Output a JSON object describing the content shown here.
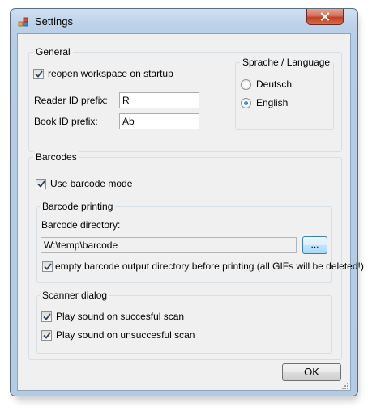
{
  "window": {
    "title": "Settings",
    "close_glyph": "✕",
    "app_icon": "settings-app-icon"
  },
  "general": {
    "label": "General",
    "reopen_workspace": {
      "label": "reopen workspace on startup",
      "checked": true
    },
    "reader_id": {
      "label": "Reader ID prefix:",
      "value": "R"
    },
    "book_id": {
      "label": "Book ID prefix:",
      "value": "Ab"
    },
    "language": {
      "label": "Sprache / Language",
      "options": [
        {
          "label": "Deutsch",
          "selected": false
        },
        {
          "label": "English",
          "selected": true
        }
      ]
    }
  },
  "barcodes": {
    "label": "Barcodes",
    "use_barcode_mode": {
      "label": "Use barcode mode",
      "checked": true
    },
    "printing": {
      "label": "Barcode printing",
      "directory_label": "Barcode directory:",
      "directory_value": "W:\\temp\\barcode",
      "browse_label": "...",
      "empty_dir": {
        "label": "empty barcode output directory before printing (all GIFs will be deleted!)",
        "checked": true
      }
    },
    "scanner": {
      "label": "Scanner dialog",
      "sound_success": {
        "label": "Play sound on succesful scan",
        "checked": true
      },
      "sound_failure": {
        "label": "Play sound on unsuccesful scan",
        "checked": true
      }
    }
  },
  "ok_label": "OK",
  "colors": {
    "accent": "#3c7fb1",
    "close": "#c23f23",
    "frame": "#b6cde6"
  }
}
